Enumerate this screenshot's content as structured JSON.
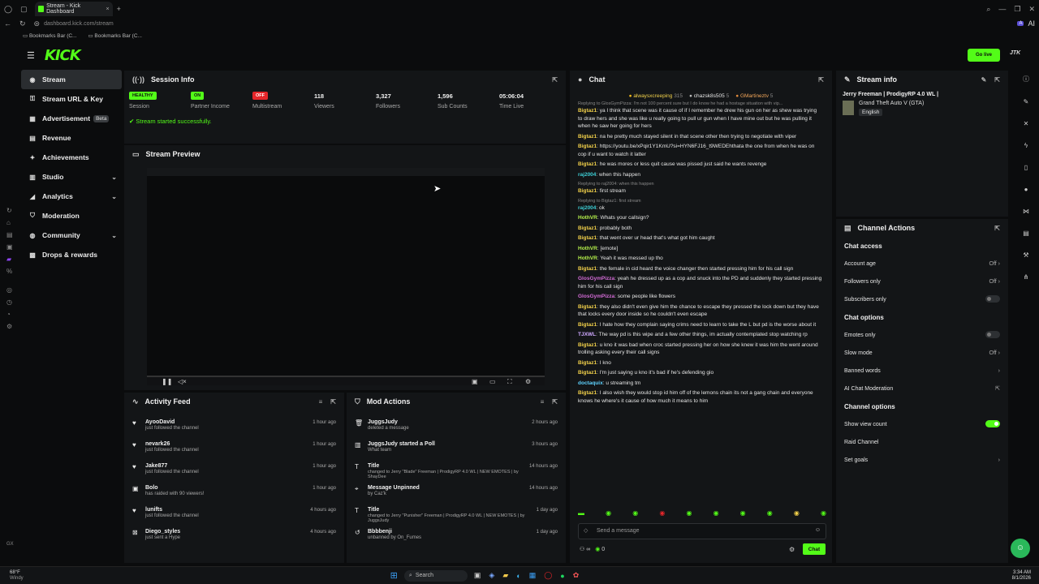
{
  "browser": {
    "tab_title": "Stream - Kick Dashboard",
    "url": "dashboard.kick.com/stream",
    "bookmarks": [
      "Bookmarks Bar (C...",
      "Bookmarks Bar (C..."
    ],
    "ai_label": "AI"
  },
  "header": {
    "logo": "KICK",
    "go_live_label": "Go live",
    "avatar_text": "JTK"
  },
  "sidebar": {
    "items": [
      {
        "label": "Stream",
        "icon": "broadcast-icon"
      },
      {
        "label": "Stream URL & Key",
        "icon": "key-icon"
      },
      {
        "label": "Advertisement",
        "icon": "ad-icon",
        "badge": "Beta"
      },
      {
        "label": "Revenue",
        "icon": "revenue-icon"
      },
      {
        "label": "Achievements",
        "icon": "trophy-icon"
      },
      {
        "label": "Studio",
        "icon": "studio-icon"
      },
      {
        "label": "Analytics",
        "icon": "chart-icon"
      },
      {
        "label": "Moderation",
        "icon": "shield-icon"
      },
      {
        "label": "Community",
        "icon": "users-icon"
      },
      {
        "label": "Drops & rewards",
        "icon": "gift-icon"
      }
    ]
  },
  "session": {
    "title": "Session Info",
    "stats": [
      {
        "top": "HEALTHY",
        "bottom": "Session",
        "color": "#53fc18"
      },
      {
        "top": "ON",
        "bottom": "Partner Income",
        "color": "#53fc18"
      },
      {
        "top": "OFF",
        "bottom": "Multistream",
        "color": "#e5262a"
      },
      {
        "top": "118",
        "bottom": "Viewers"
      },
      {
        "top": "3,327",
        "bottom": "Followers"
      },
      {
        "top": "1,596",
        "bottom": "Sub Counts"
      },
      {
        "top": "05:06:04",
        "bottom": "Time Live"
      }
    ],
    "success": "Stream started successfully."
  },
  "preview": {
    "title": "Stream Preview"
  },
  "activity": {
    "title": "Activity Feed",
    "items": [
      {
        "name": "AyooDavid",
        "sub": "just followed the channel",
        "time": "1 hour ago"
      },
      {
        "name": "nevark26",
        "sub": "just followed the channel",
        "time": "1 hour ago"
      },
      {
        "name": "Jake877",
        "sub": "just followed the channel",
        "time": "1 hour ago"
      },
      {
        "name": "Bolo",
        "sub": "has raided with 90 viewers!",
        "time": "1 hour ago"
      },
      {
        "name": "lunifts",
        "sub": "just followed the channel",
        "time": "4 hours ago"
      },
      {
        "name": "Diego_styles",
        "sub": "just sent a Hype",
        "time": "4 hours ago"
      }
    ]
  },
  "mod": {
    "title": "Mod Actions",
    "items": [
      {
        "name": "JuggsJudy",
        "sub": "deleted a message",
        "time": "2 hours ago"
      },
      {
        "name": "JuggsJudy started a Poll",
        "sub": "What team",
        "time": "3 hours ago"
      },
      {
        "name": "Title",
        "sub": "changed to Jerry \"Blade\" Freeman | ProdigyRP 4.0 WL | NEW EMOTES | by ShayDee",
        "time": "14 hours ago"
      },
      {
        "name": "Message Unpinned",
        "sub": "by Caz'k",
        "time": "14 hours ago"
      },
      {
        "name": "Title",
        "sub": "changed to Jerry \"Punisher\" Freeman | ProdigyRP 4.0 WL | NEW EMOTES | by JuggsJudy",
        "time": "1 day ago"
      },
      {
        "name": "Bbbbenji",
        "sub": "unbanned by On_Fumes",
        "time": "1 day ago"
      }
    ]
  },
  "chat": {
    "title": "Chat",
    "pinned": [
      "alwaysxcreeping",
      "chazsk8s505",
      "GMartineztv"
    ],
    "pinned_counts": [
      "315",
      "5",
      "5"
    ],
    "messages": [
      {
        "reply": "Replying to GlosGymPizza: I'm not 100 percent sure but I do know he had a hostage situation with vip..."
      },
      {
        "user": "Bigtaz1",
        "color": "#f2d14b",
        "text": "ya I think that scene was it cause of if I remember he drew his gun on her as shew was trying to draw hers and she was like u really going to pull ur gun when I have mine out but he was pulling it when he saw her going for hers"
      },
      {
        "user": "Bigtaz1",
        "color": "#f2d14b",
        "text": "na he pretty much stayed silent in that scene other then trying to negotiate with viper"
      },
      {
        "user": "Bigtaz1",
        "color": "#f2d14b",
        "text": "https://youtu.be/xPqir1Y1KmU?si=HYN6FJ16_t9WEDEhthata the one from when he was on cop if u want to watch it latter"
      },
      {
        "user": "Bigtaz1",
        "color": "#f2d14b",
        "text": "he was mores or less quit cause was pissed just said he wants revenge"
      },
      {
        "user": "raj2004",
        "color": "#3ecfd6",
        "text": "when this happen"
      },
      {
        "reply": "Replying to raj2004: when this happen"
      },
      {
        "user": "Bigtaz1",
        "color": "#f2d14b",
        "text": "first stream"
      },
      {
        "reply": "Replying to Bigtaz1: first stream"
      },
      {
        "user": "raj2004",
        "color": "#3ecfd6",
        "text": "ok"
      },
      {
        "user": "HothVR",
        "color": "#b6f24b",
        "text": "Whats your callsign?"
      },
      {
        "user": "Bigtaz1",
        "color": "#f2d14b",
        "text": "probably both"
      },
      {
        "user": "Bigtaz1",
        "color": "#f2d14b",
        "text": "that went over ur head that's what got him caught"
      },
      {
        "user": "HothVR",
        "color": "#b6f24b",
        "text": "[emote]"
      },
      {
        "user": "HothVR",
        "color": "#b6f24b",
        "text": "Yeah it was messed up tho"
      },
      {
        "user": "Bigtaz1",
        "color": "#f2d14b",
        "text": "the female in cid heard the voice changer then started pressing him for his call sign"
      },
      {
        "user": "GlosGymPizza",
        "color": "#d36bd6",
        "text": "yeah he dressed up as a cop and snuck into the PD and suddenly they started pressing him for his call sign"
      },
      {
        "user": "GlosGymPizza",
        "color": "#d36bd6",
        "text": "some people like flowers"
      },
      {
        "user": "Bigtaz1",
        "color": "#f2d14b",
        "text": "they also didn't even give him the chance to escape they pressed the lock down but they have that locks every door inside so he couldn't even escape"
      },
      {
        "user": "Bigtaz1",
        "color": "#f2d14b",
        "text": "I hate how they complain saying crims need to learn to take the L but pd is the worse about it"
      },
      {
        "user": "TJXWL",
        "color": "#cfa9ff",
        "text": "The way pd is this wipe and a few other things, im actually contemplated stop watching rp"
      },
      {
        "user": "Bigtaz1",
        "color": "#f2d14b",
        "text": "u kno it was bad when croc started pressing her on how she knew it was him the went around trolling asking every their call signs"
      },
      {
        "user": "Bigtaz1",
        "color": "#f2d14b",
        "text": "I kno"
      },
      {
        "user": "Bigtaz1",
        "color": "#f2d14b",
        "text": "I'm just saying u kno it's bad if he's defending gio"
      },
      {
        "user": "doctaquix",
        "color": "#5fd3ff",
        "text": "u streaming tm"
      },
      {
        "user": "Bigtaz1",
        "color": "#f2d14b",
        "text": "I also wish they would stop id him off of the lemons chain its not a gang chain and everyone knows he where's it cause of how much it means to him"
      }
    ],
    "input_placeholder": "Send a message",
    "points": "0",
    "send_label": "Chat"
  },
  "stream_info": {
    "title": "Stream info",
    "stream_title": "Jerry Freeman | ProdigyRP 4.0 WL |",
    "category": "Grand Theft Auto V (GTA)",
    "language": "English"
  },
  "channel_actions": {
    "title": "Channel Actions",
    "chat_access": "Chat access",
    "account_age": "Account age",
    "account_age_value": "Off",
    "followers_only": "Followers only",
    "followers_only_value": "Off",
    "subscribers_only": "Subscribers only",
    "chat_options": "Chat options",
    "emotes_only": "Emotes only",
    "slow_mode": "Slow mode",
    "slow_mode_value": "Off",
    "banned_words": "Banned words",
    "ai_chat_moderation": "AI Chat Moderation",
    "channel_options": "Channel options",
    "show_view_count": "Show view count",
    "raid_channel": "Raid Channel",
    "set_goals": "Set goals"
  },
  "taskbar": {
    "weather_temp": "68°F",
    "weather_desc": "Windy",
    "search": "Search",
    "time": "3:34 AM",
    "date": "8/1/2026"
  }
}
